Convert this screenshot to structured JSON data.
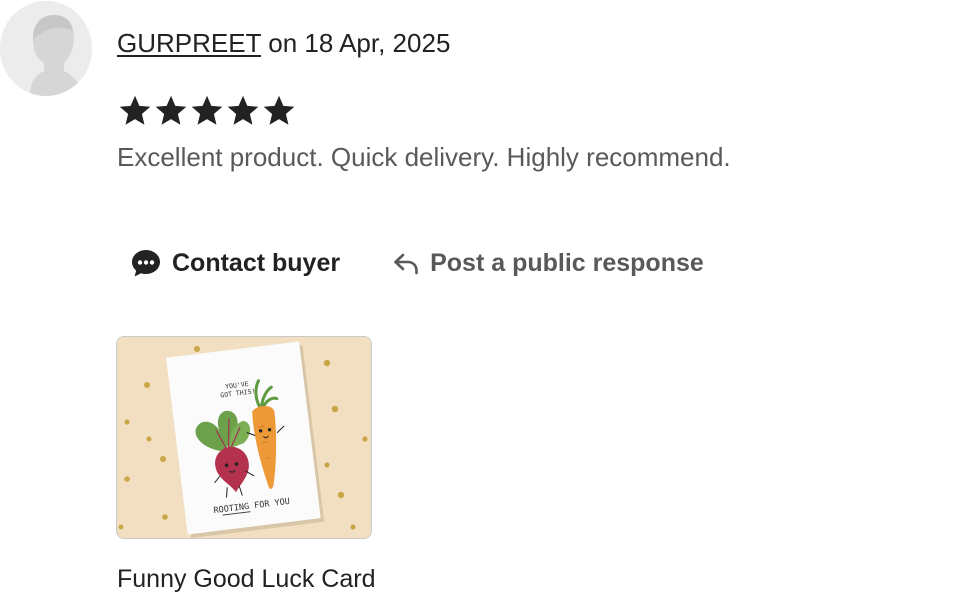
{
  "review": {
    "reviewer_name": "GURPREET",
    "date_text": "on 18 Apr, 2025",
    "rating": 5,
    "rating_max": 5,
    "text": "Excellent product. Quick delivery. Highly recommend."
  },
  "actions": {
    "contact_label": "Contact buyer",
    "respond_label": "Post a public response"
  },
  "listing": {
    "title": "Funny Good Luck Card",
    "card_text_top": "YOU'VE GOT THIS!",
    "card_text_bottom": "ROOTING FOR YOU"
  },
  "icons": {
    "contact": "chat-bubble-icon",
    "respond": "reply-arrow-icon",
    "star": "star-icon",
    "avatar": "default-avatar-icon"
  },
  "colors": {
    "text": "#222222",
    "muted_text": "#595959",
    "star": "#222222",
    "thumb_background": "#f2dfc1"
  }
}
